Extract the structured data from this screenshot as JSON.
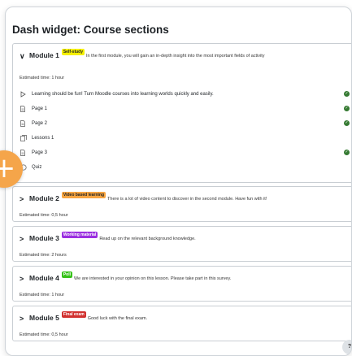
{
  "widget": {
    "title": "Dash widget: Course sections"
  },
  "modules": [
    {
      "title": "Module 1",
      "badge": "Self-study",
      "badge_color": "#f5f000",
      "badge_text_color": "#1d2125",
      "description": "In the first module, you will gain an in-depth insight into the most important fields of activity",
      "estimated": "Estimated time: 1 hour",
      "expanded": true,
      "activities": [
        {
          "icon": "play-icon",
          "label": "Learning should be fun! Turn Moodle courses into learning worlds quickly and easily.",
          "completed": true
        },
        {
          "icon": "page-icon",
          "label": "Page 1",
          "completed": true
        },
        {
          "icon": "page-icon",
          "label": "Page 2",
          "completed": true
        },
        {
          "icon": "lesson-icon",
          "label": "Lessons 1",
          "completed": false
        },
        {
          "icon": "page-icon",
          "label": "Page 3",
          "completed": true
        },
        {
          "icon": "quiz-icon",
          "label": "Quiz",
          "completed": false
        }
      ]
    },
    {
      "title": "Module 2",
      "badge": "Video based learning",
      "badge_color": "#f7a541",
      "badge_text_color": "#1d2125",
      "description": "There is a lot of video content to discover in the second module. Have fun with it!",
      "estimated": "Estimated time: 0,5 hour",
      "expanded": false
    },
    {
      "title": "Module 3",
      "badge": "Working material",
      "badge_color": "#9b30e0",
      "badge_text_color": "#ffffff",
      "description": "Read up on the relevant background knowledge.",
      "estimated": "Estimated time: 2 hours",
      "expanded": false
    },
    {
      "title": "Module 4",
      "badge": "Poll",
      "badge_color": "#37c21a",
      "badge_text_color": "#ffffff",
      "description": "We are interested in your opinion on this lesson. Please take part in this survey.",
      "estimated": "Estimated time: 1 hour",
      "expanded": false
    },
    {
      "title": "Module 5",
      "badge": "Final exam",
      "badge_color": "#d1312f",
      "badge_text_color": "#ffffff",
      "description": "Good luck with the final exam.",
      "estimated": "Estimated time: 0,5 hour",
      "expanded": false
    }
  ],
  "buttons": {
    "add_symbol": "+",
    "help_symbol": "?"
  },
  "colors": {
    "complete_check": "#357a32",
    "add_button": "#f5a54a"
  }
}
